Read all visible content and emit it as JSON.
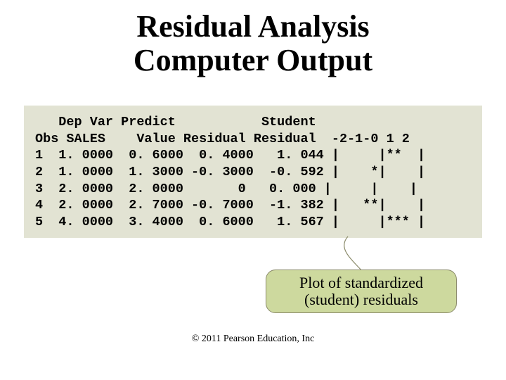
{
  "title_line1": "Residual Analysis",
  "title_line2": "Computer Output",
  "output": {
    "header_line1": "   Dep Var Predict           Student",
    "header_line2": "Obs SALES    Value Residual Residual  -2-1-0 1 2",
    "rows": [
      "1  1. 0000  0. 6000  0. 4000   1. 044 |     |**  |",
      "2  1. 0000  1. 3000 -0. 3000  -0. 592 |    *|    |",
      "3  2. 0000  2. 0000       0   0. 000 |     |    |",
      "4  2. 0000  2. 7000 -0. 7000  -1. 382 |   **|    |",
      "5  4. 0000  3. 4000  0. 6000   1. 567 |     |*** |"
    ]
  },
  "callout_line1": "Plot of standardized",
  "callout_line2": "(student) residuals",
  "copyright": "© 2011 Pearson Education, Inc",
  "chart_data": {
    "type": "table",
    "title": "Residual Analysis Computer Output",
    "columns": [
      "Obs",
      "Dep Var SALES",
      "Predict Value",
      "Residual",
      "Student Residual",
      "Plot (-2 -1 0 1 2)"
    ],
    "rows": [
      {
        "Obs": 1,
        "SALES": 1.0,
        "Predict": 0.6,
        "Residual": 0.4,
        "Student": 1.044,
        "Plot": "|     |**  |"
      },
      {
        "Obs": 2,
        "SALES": 1.0,
        "Predict": 1.3,
        "Residual": -0.3,
        "Student": -0.592,
        "Plot": "|    *|    |"
      },
      {
        "Obs": 3,
        "SALES": 2.0,
        "Predict": 2.0,
        "Residual": 0.0,
        "Student": 0.0,
        "Plot": "|     |    |"
      },
      {
        "Obs": 4,
        "SALES": 2.0,
        "Predict": 2.7,
        "Residual": -0.7,
        "Student": -1.382,
        "Plot": "|   **|    |"
      },
      {
        "Obs": 5,
        "SALES": 4.0,
        "Predict": 3.4,
        "Residual": 0.6,
        "Student": 1.567,
        "Plot": "|     |*** |"
      }
    ],
    "plot_axis": [
      -2,
      -1,
      0,
      1,
      2
    ],
    "callout": "Plot of standardized (student) residuals"
  }
}
